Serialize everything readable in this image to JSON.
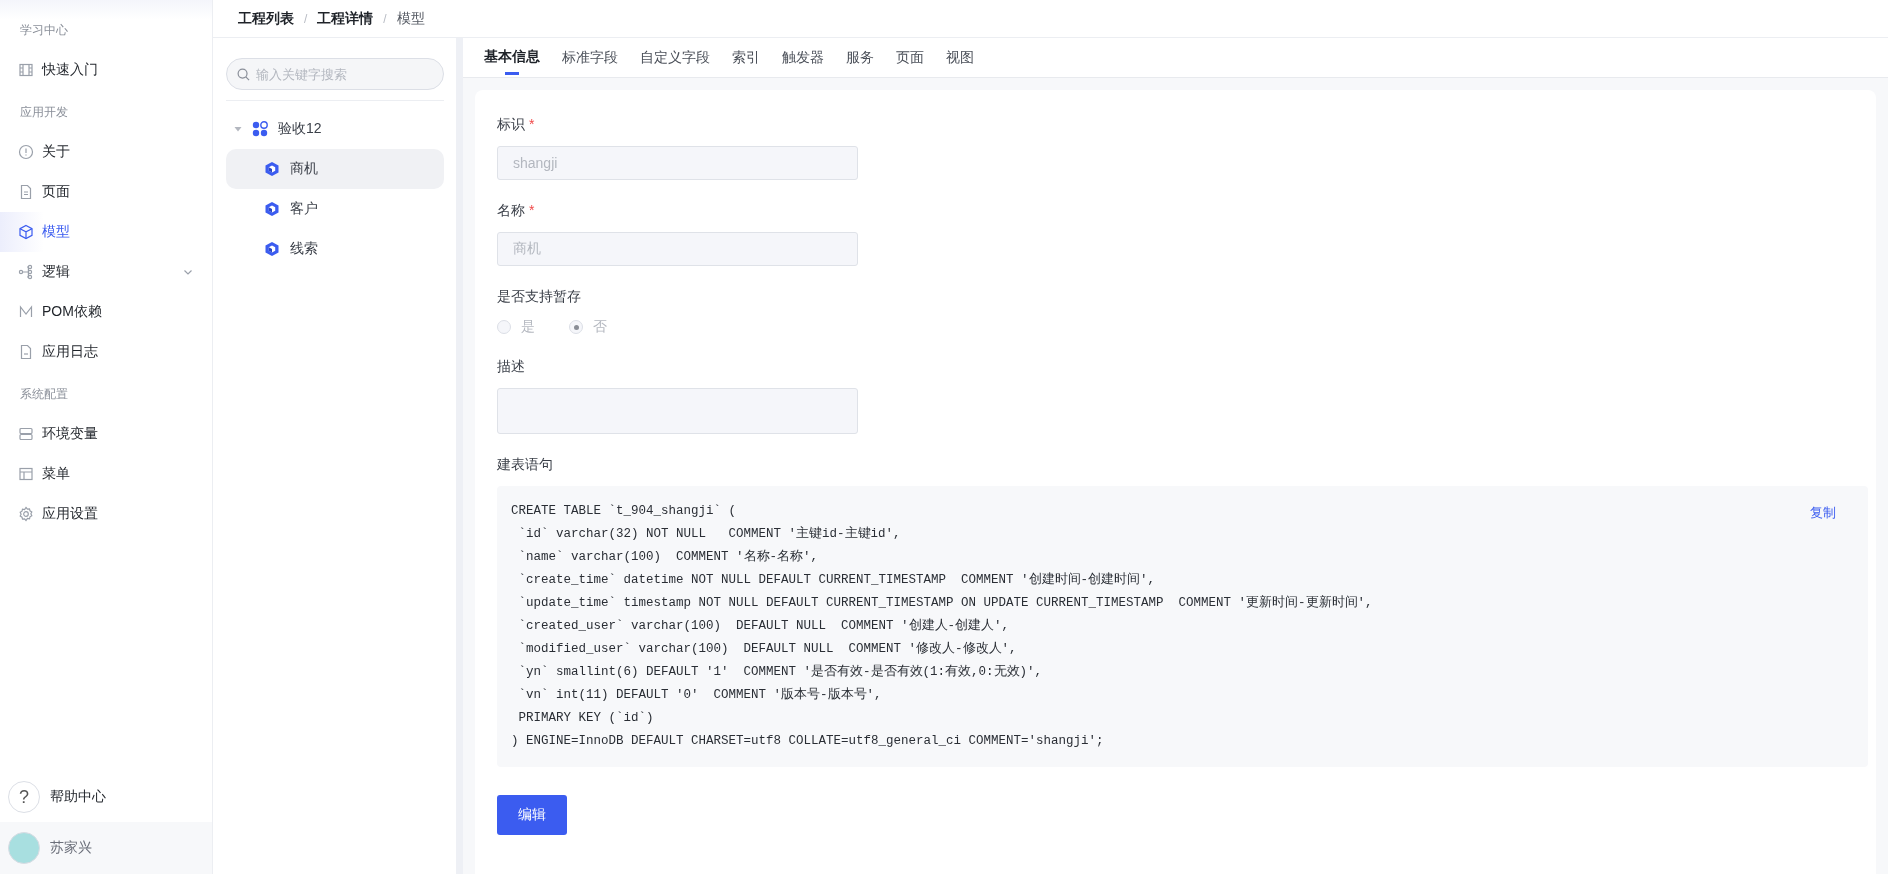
{
  "sidebar": {
    "sections": [
      {
        "title": "学习中心",
        "items": [
          {
            "label": "快速入门",
            "selected": false
          }
        ]
      },
      {
        "title": "应用开发",
        "items": [
          {
            "label": "关于",
            "selected": false
          },
          {
            "label": "页面",
            "selected": false
          },
          {
            "label": "模型",
            "selected": true
          },
          {
            "label": "逻辑",
            "selected": false,
            "expanded": false
          },
          {
            "label": "POM依赖",
            "selected": false
          },
          {
            "label": "应用日志",
            "selected": false
          }
        ]
      },
      {
        "title": "系统配置",
        "items": [
          {
            "label": "环境变量",
            "selected": false
          },
          {
            "label": "菜单",
            "selected": false
          },
          {
            "label": "应用设置",
            "selected": false
          }
        ]
      }
    ],
    "help": {
      "label": "帮助中心",
      "icon_text": "?"
    },
    "user": {
      "name": "苏家兴"
    }
  },
  "breadcrumb": {
    "separator": "/",
    "items": [
      {
        "label": "工程列表",
        "current": false
      },
      {
        "label": "工程详情",
        "current": false
      },
      {
        "label": "模型",
        "current": true
      }
    ]
  },
  "tree": {
    "search": {
      "placeholder": "输入关键字搜索"
    },
    "root": {
      "label": "验收12",
      "expanded": true,
      "children": [
        {
          "label": "商机",
          "selected": true
        },
        {
          "label": "客户",
          "selected": false
        },
        {
          "label": "线索",
          "selected": false
        }
      ]
    }
  },
  "tabs": [
    {
      "label": "基本信息",
      "selected": true
    },
    {
      "label": "标准字段",
      "selected": false
    },
    {
      "label": "自定义字段",
      "selected": false
    },
    {
      "label": "索引",
      "selected": false
    },
    {
      "label": "触发器",
      "selected": false
    },
    {
      "label": "服务",
      "selected": false
    },
    {
      "label": "页面",
      "selected": false
    },
    {
      "label": "视图",
      "selected": false
    }
  ],
  "form": {
    "required_mark": "*",
    "fields": [
      {
        "kind": "text",
        "label": "标识",
        "required": true,
        "disabled": true,
        "value": "shangji"
      },
      {
        "kind": "text",
        "label": "名称",
        "required": true,
        "disabled": true,
        "value": "商机"
      },
      {
        "kind": "radio",
        "label": "是否支持暂存",
        "required": false,
        "disabled": true,
        "options": [
          {
            "label": "是",
            "selected": false
          },
          {
            "label": "否",
            "selected": true
          }
        ]
      },
      {
        "kind": "textarea",
        "label": "描述",
        "required": false,
        "disabled": true
      },
      {
        "kind": "code",
        "label": "建表语句",
        "required": false,
        "copy_label": "复制",
        "lines": [
          "CREATE TABLE `t_904_shangji` (",
          " `id` varchar(32) NOT NULL   COMMENT '主键id-主键id',",
          " `name` varchar(100)  COMMENT '名称-名称',",
          " `create_time` datetime NOT NULL DEFAULT CURRENT_TIMESTAMP  COMMENT '创建时间-创建时间',",
          " `update_time` timestamp NOT NULL DEFAULT CURRENT_TIMESTAMP ON UPDATE CURRENT_TIMESTAMP  COMMENT '更新时间-更新时间',",
          " `created_user` varchar(100)  DEFAULT NULL  COMMENT '创建人-创建人',",
          " `modified_user` varchar(100)  DEFAULT NULL  COMMENT '修改人-修改人',",
          " `yn` smallint(6) DEFAULT '1'  COMMENT '是否有效-是否有效(1:有效,0:无效)',",
          " `vn` int(11) DEFAULT '0'  COMMENT '版本号-版本号',",
          " PRIMARY KEY (`id`)",
          ") ENGINE=InnoDB DEFAULT CHARSET=utf8 COLLATE=utf8_general_ci COMMENT='shangji';"
        ]
      }
    ],
    "submit": "编辑"
  }
}
